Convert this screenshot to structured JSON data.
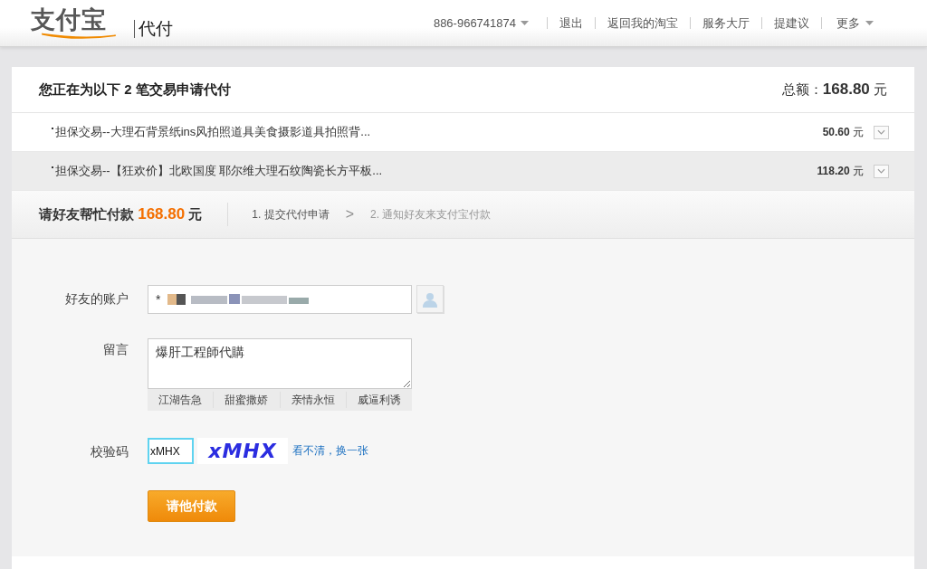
{
  "header": {
    "logo": "支付宝",
    "product": "代付",
    "account": "886-966741874",
    "links": [
      "退出",
      "返回我的淘宝",
      "服务大厅",
      "提建议"
    ],
    "more": "更多"
  },
  "order": {
    "title_prefix": "您正在为以下",
    "count": "2",
    "title_suffix": "笔交易申请代付",
    "total_label": "总额：",
    "total": "168.80",
    "total_unit": "元",
    "rows": [
      {
        "text": "担保交易--大理石背景纸ins风拍照道具美食摄影道具拍照背...",
        "amount": "50.60",
        "unit": "元",
        "selected": false
      },
      {
        "text": "担保交易--【狂欢价】北欧国度 耶尔维大理石纹陶瓷长方平板...",
        "amount": "118.20",
        "unit": "元",
        "selected": true
      }
    ]
  },
  "request": {
    "label": "请好友帮忙付款",
    "amount": "168.80",
    "unit": "元",
    "steps": [
      {
        "text": "1. 提交代付申请",
        "selected": true
      },
      {
        "text": "2. 通知好友来支付宝付款",
        "selected": false
      }
    ],
    "separator": ">"
  },
  "form": {
    "account_label": "好友的账户",
    "account_prefix": "*",
    "message_label": "留言",
    "message": "爆肝工程師代購",
    "presets": [
      "江湖告急",
      "甜蜜撒娇",
      "亲情永恒",
      "威逼利诱"
    ],
    "captcha_label": "校验码",
    "captcha_value": "xMHX",
    "captcha_image": "xMHX",
    "captcha_link": "看不清，换一张",
    "submit": "请他付款"
  }
}
